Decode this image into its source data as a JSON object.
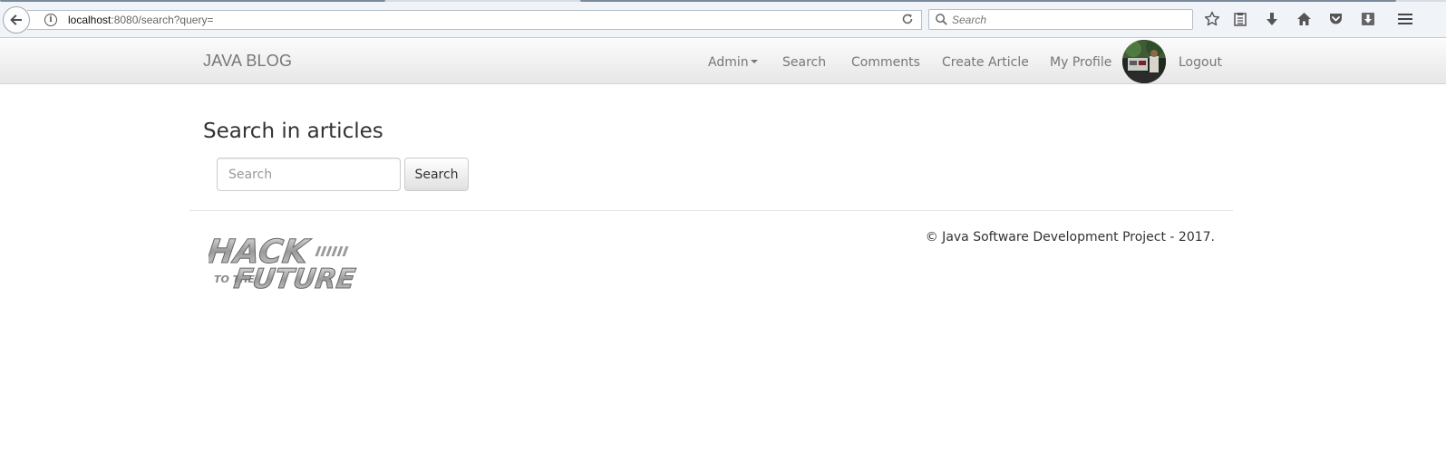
{
  "browser": {
    "url_host": "localhost",
    "url_rest": ":8080/search?query=",
    "search_placeholder": "Search"
  },
  "navbar": {
    "brand": "JAVA BLOG",
    "items": [
      {
        "label": "Admin",
        "has_caret": true
      },
      {
        "label": "Search"
      },
      {
        "label": "Comments"
      },
      {
        "label": "Create Article"
      },
      {
        "label": "My Profile"
      },
      {
        "label": "Logout"
      }
    ]
  },
  "main": {
    "title": "Search in articles",
    "search_placeholder": "Search",
    "search_button": "Search"
  },
  "footer": {
    "logo_text_top": "HACK",
    "logo_text_small": "TO THE",
    "logo_text_bottom": "FUTURE",
    "copyright": "© Java Software Development Project - 2017."
  },
  "colors": {
    "navbar_text": "#777777",
    "body_text": "#333333"
  }
}
